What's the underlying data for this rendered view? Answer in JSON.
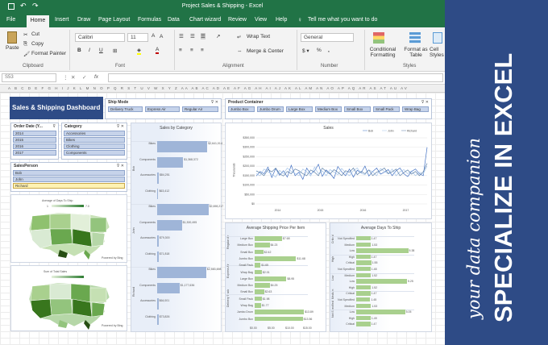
{
  "window": {
    "title": "Project Sales & Shipping  -  Excel"
  },
  "menu": [
    "File",
    "Home",
    "Insert",
    "Draw",
    "Page Layout",
    "Formulas",
    "Data",
    "Chart wizard",
    "Review",
    "View",
    "Help"
  ],
  "tell_me": "Tell me what you want to do",
  "ribbon": {
    "paste": "Paste",
    "cut": "Cut",
    "copy": "Copy",
    "format_painter": "Format Painter",
    "clipboard": "Clipboard",
    "font_name": "Calibri",
    "font_size": "11",
    "font": "Font",
    "wrap_text": "Wrap Text",
    "merge_center": "Merge & Center",
    "alignment": "Alignment",
    "number_format": "General",
    "number": "Number",
    "conditional_formatting": "Conditional Formatting",
    "format_as_table": "Format as Table",
    "cell_styles": "Cell Styles",
    "styles": "Styles"
  },
  "formula_bar": {
    "name_box": "S53",
    "fx": "fx"
  },
  "columns": "A  B  C  D  E  F  G  H  I  J  K  L  M  N  O  P  Q  R  S  T  U  V  W  X  Y  Z  AA  AB  AC  AD  AE  AF  AG  AH  AI  AJ  AK  AL  AM  AN  AO  AP  AQ  AR  AS  AT  AU  AV",
  "dashboard": {
    "title": "Sales & Shipping Dashboard",
    "ship_mode": {
      "title": "Ship Mode",
      "items": [
        "Delivery Truck",
        "Express Air",
        "Regular Air"
      ]
    },
    "product_container": {
      "title": "Product Container",
      "items": [
        "Jumbo Box",
        "Jumbo Drum",
        "Large Box",
        "Medium Box",
        "Small Box",
        "Small Pack",
        "Wrap Bag"
      ]
    },
    "order_date": {
      "title": "Order Date (Y...",
      "items": [
        "2014",
        "2015",
        "2016",
        "2017"
      ]
    },
    "category": {
      "title": "Category",
      "items": [
        "Accessories",
        "Bikes",
        "Clothing",
        "Components"
      ]
    },
    "salesperson": {
      "title": "SalesPerson",
      "items": [
        "Bob",
        "John",
        "Richard"
      ],
      "selected": "Richard"
    },
    "map1": {
      "title": "Average of Days To Ship",
      "low": "1",
      "high": "7.0",
      "credit": "Powered by Bing"
    },
    "map2": {
      "title": "Sum of Total Sales",
      "credit": "Powered by Bing"
    }
  },
  "chart_data": [
    {
      "type": "bar",
      "title": "Sales by Category",
      "groups": [
        "Bob",
        "John",
        "Richard"
      ],
      "categories": [
        "Bikes",
        "Components",
        "Accessories",
        "Clothing"
      ],
      "series": [
        {
          "name": "Bob",
          "values": [
            2641014,
            1368372,
            84251,
            63412
          ]
        },
        {
          "name": "John",
          "values": [
            2698217,
            1300495,
            79300,
            71818
          ]
        },
        {
          "name": "Richard",
          "values": [
            2583698,
            1177636,
            64001,
            73826
          ]
        }
      ],
      "data_labels": [
        "$2,641,014",
        "$1,368,372",
        "$84,251",
        "$63,412",
        "$2,698,217",
        "$1,300,495",
        "$79,300",
        "$71,818",
        "$2,583,698",
        "$1,177,636",
        "$64,001",
        "$73,826"
      ]
    },
    {
      "type": "line",
      "title": "Sales",
      "ylabel": "Thousands",
      "legend": [
        "Bob",
        "John",
        "Richard"
      ],
      "legend_position": "top-right",
      "colors": [
        "#4472c4",
        "#a5c4e8",
        "#5b7fa8"
      ],
      "ylim": [
        0,
        350
      ],
      "yticks": [
        "$350,000",
        "$300,000",
        "$250,000",
        "$200,000",
        "$150,000",
        "$100,000",
        "$50,000",
        "$0"
      ],
      "x_groups": [
        "2014",
        "2015",
        "2016",
        "2017"
      ],
      "series": [
        {
          "name": "Bob",
          "values": [
            148,
            172,
            160,
            195,
            140,
            188,
            152,
            176,
            142,
            205,
            150,
            168,
            130,
            190,
            158,
            175,
            210,
            146,
            180,
            162,
            135,
            198,
            170,
            150,
            185,
            142,
            178,
            165,
            200,
            148,
            172,
            190,
            158,
            168,
            182,
            150,
            176,
            190,
            160,
            145,
            172,
            185,
            160,
            150,
            300
          ]
        },
        {
          "name": "John",
          "values": [
            160,
            150,
            185,
            170,
            158,
            142,
            178,
            160,
            190,
            172,
            162,
            150,
            185,
            170,
            148,
            195,
            160,
            175,
            150,
            182,
            168,
            155,
            188,
            165,
            150,
            176,
            190,
            162,
            155,
            180,
            170,
            150,
            188,
            172,
            160,
            185,
            150,
            170,
            182,
            160,
            175,
            150,
            168,
            160,
            200
          ]
        },
        {
          "name": "Richard",
          "values": [
            175,
            165,
            150,
            182,
            170,
            190,
            160,
            148,
            172,
            160,
            185,
            176,
            160,
            150,
            180,
            168,
            150,
            190,
            172,
            158,
            182,
            168,
            150,
            176,
            168,
            190,
            155,
            172,
            160,
            180,
            150,
            168,
            176,
            190,
            160,
            170,
            185,
            150,
            166,
            180,
            158,
            172,
            150,
            170,
            215
          ]
        }
      ]
    },
    {
      "type": "bar",
      "title": "Average Shipping Price Per Item",
      "groups": [
        "Regular Air",
        "Express Air",
        "Delivery Truck"
      ],
      "categories": [
        "Large Box",
        "Medium Box",
        "Small Box",
        "Jumbo Box",
        "Small Pack",
        "Wrap Bag",
        "Large Box",
        "Medium Box",
        "Small Box",
        "Small Pack",
        "Wrap Bag",
        "Jumbo Drum",
        "Jumbo Box"
      ],
      "values": [
        7.68,
        4.23,
        2.42,
        11.68,
        1.65,
        2.01,
        8.95,
        4.25,
        2.63,
        1.98,
        1.77,
        13.89,
        13.56
      ],
      "data_labels": [
        "$7.68",
        "$4.23",
        "$2.42",
        "$11.68",
        "$1.65",
        "$2.01",
        "$8.95",
        "$4.25",
        "$2.63",
        "$1.98",
        "$1.77",
        "$13.89",
        "$13.56"
      ],
      "xticks": [
        "$0.00",
        "$5.00",
        "$10.00",
        "$15.00"
      ]
    },
    {
      "type": "bar",
      "title": "Average Days To Ship",
      "groups": [
        "Critical",
        "High",
        "Low",
        "Medium",
        "Not Specified"
      ],
      "categories": [
        "Not Specified",
        "Medium",
        "Low",
        "High",
        "Critical",
        "Not Specified",
        "Medium",
        "Low",
        "High",
        "Critical",
        "Not Specified",
        "Medium",
        "Low",
        "High",
        "Critical"
      ],
      "values": [
        1.47,
        1.53,
        5.38,
        1.47,
        1.55,
        1.48,
        1.52,
        5.25,
        1.52,
        1.47,
        1.45,
        1.53,
        5.05,
        1.49,
        1.47
      ],
      "data_labels": [
        "1.47",
        "1.53",
        "5.38",
        "1.47",
        "1.55",
        "1.48",
        "1.52",
        "5.25",
        "1.52",
        "1.47",
        "1.45",
        "1.53",
        "5.05",
        "1.49",
        "1.47"
      ]
    }
  ],
  "sidebar": {
    "line1": "your data companion",
    "line2": "SPECIALIZE IN EXCEL",
    "bg": "#2e4b86"
  }
}
